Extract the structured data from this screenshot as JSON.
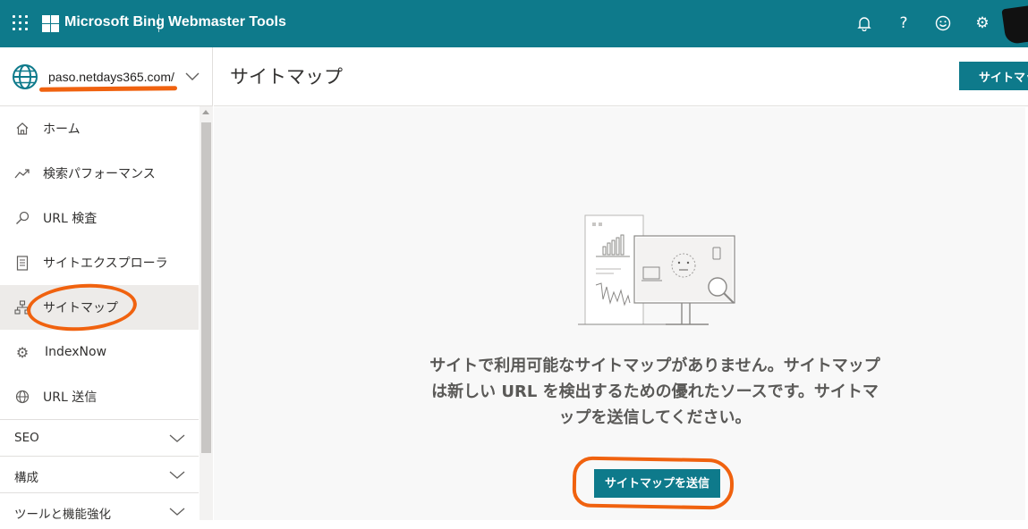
{
  "topbar": {
    "brand": "Microsoft Bing",
    "product": "Webmaster Tools",
    "icons": [
      "bell-icon",
      "help-icon",
      "feedback-smiley-icon",
      "settings-gear-icon"
    ]
  },
  "site": {
    "url": "paso.netdays365.com/"
  },
  "nav": {
    "items": [
      {
        "label": "ホーム",
        "icon": "home-icon"
      },
      {
        "label": "検索パフォーマンス",
        "icon": "trend-icon"
      },
      {
        "label": "URL 検査",
        "icon": "search-icon"
      },
      {
        "label": "サイトエクスプローラ",
        "icon": "document-icon"
      },
      {
        "label": "サイトマップ",
        "icon": "sitemap-icon",
        "active": true
      },
      {
        "label": "IndexNow",
        "icon": "gear-icon"
      },
      {
        "label": "URL 送信",
        "icon": "globe-icon"
      }
    ],
    "sections": [
      {
        "label": "SEO"
      },
      {
        "label": "構成"
      },
      {
        "label": "ツールと機能強化"
      }
    ]
  },
  "main": {
    "title": "サイトマップ",
    "header_button": "サイトマップを送信",
    "empty_message": "サイトで利用可能なサイトマップがありません。サイトマップは新しい URL を検出するための優れたソースです。サイトマップを送信してください。",
    "submit_button": "サイトマップを送信"
  },
  "colors": {
    "brand_teal": "#0e7a8b",
    "annotation_orange": "#f0620f"
  }
}
